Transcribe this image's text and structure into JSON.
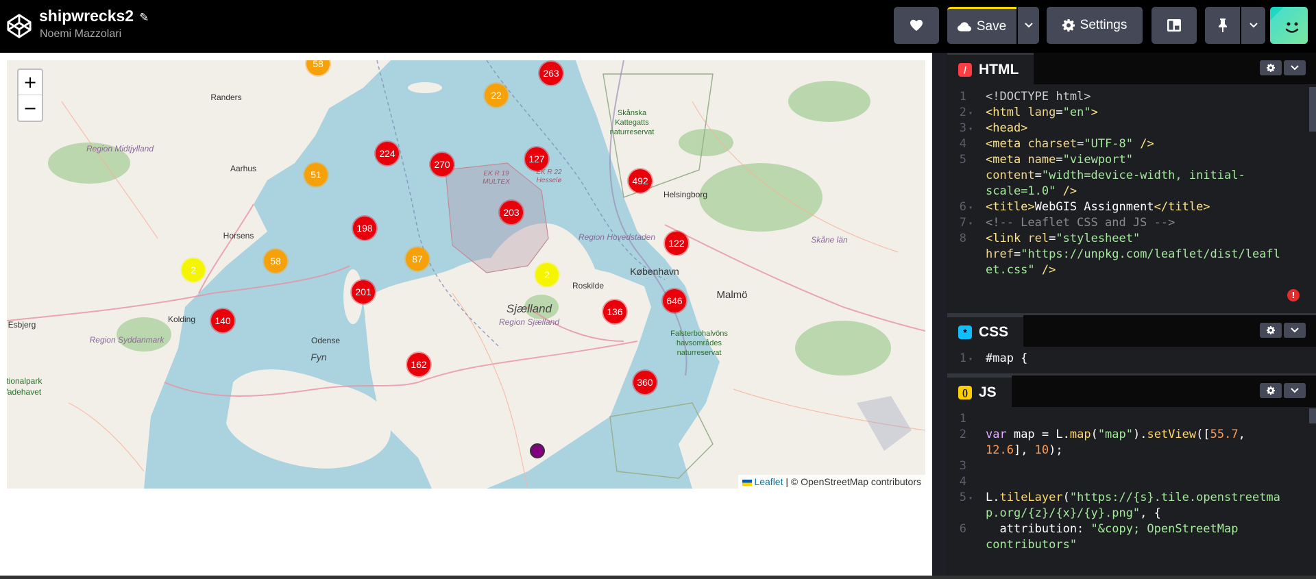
{
  "app": {
    "pen_title": "shipwrecks2",
    "author": "Noemi Mazzolari",
    "buttons": {
      "love_icon": "heart-icon",
      "save_label": "Save",
      "settings_label": "Settings",
      "layout_icon": "layout-icon",
      "pin_icon": "pin-icon"
    }
  },
  "map": {
    "zoom_in": "+",
    "zoom_out": "−",
    "attribution_link": "Leaflet",
    "attribution_rest": "| © OpenStreetMap contributors",
    "place_labels": [
      {
        "id": "randers",
        "text": "Randers"
      },
      {
        "id": "region-midtjylland",
        "text": "Region Midtjylland"
      },
      {
        "id": "aarhus",
        "text": "Aarhus"
      },
      {
        "id": "horsens",
        "text": "Horsens"
      },
      {
        "id": "kolding",
        "text": "Kolding"
      },
      {
        "id": "esbjerg",
        "text": "Esbjerg"
      },
      {
        "id": "region-syddanmark",
        "text": "Region Syddanmark"
      },
      {
        "id": "odense",
        "text": "Odense"
      },
      {
        "id": "fyn",
        "text": "Fyn"
      },
      {
        "id": "nationalpark",
        "text": "ationalpark"
      },
      {
        "id": "vadehavet",
        "text": "Vadehavet"
      },
      {
        "id": "sjaelland",
        "text": "Sjælland"
      },
      {
        "id": "region-sjaelland",
        "text": "Region Sjælland"
      },
      {
        "id": "roskilde",
        "text": "Roskilde"
      },
      {
        "id": "kobenhavn",
        "text": "København"
      },
      {
        "id": "region-hovedstaden",
        "text": "Region Hovedstaden"
      },
      {
        "id": "helsingborg",
        "text": "Helsingborg"
      },
      {
        "id": "malmo",
        "text": "Malmö"
      },
      {
        "id": "skane-lan",
        "text": "Skåne län"
      },
      {
        "id": "skanska-1",
        "text": "Skånska"
      },
      {
        "id": "skanska-2",
        "text": "Kattegatts"
      },
      {
        "id": "skanska-3",
        "text": "naturreservat"
      },
      {
        "id": "ekr19-1",
        "text": "EK R 19"
      },
      {
        "id": "ekr19-2",
        "text": "MULTEX"
      },
      {
        "id": "ekr22-1",
        "text": "EK R 22"
      },
      {
        "id": "ekr22-2",
        "text": "Hesselø"
      },
      {
        "id": "falster-1",
        "text": "Falsterbohalvöns"
      },
      {
        "id": "falster-2",
        "text": "havsområdes"
      },
      {
        "id": "falster-3",
        "text": "naturreservat"
      }
    ],
    "clusters": [
      {
        "count": "58",
        "color": "#f6a10a"
      },
      {
        "count": "263",
        "color": "#e8000b"
      },
      {
        "count": "22",
        "color": "#f6a10a"
      },
      {
        "count": "224",
        "color": "#e8000b"
      },
      {
        "count": "270",
        "color": "#e8000b"
      },
      {
        "count": "127",
        "color": "#e8000b"
      },
      {
        "count": "51",
        "color": "#f6a10a"
      },
      {
        "count": "492",
        "color": "#e8000b"
      },
      {
        "count": "203",
        "color": "#e8000b"
      },
      {
        "count": "198",
        "color": "#e8000b"
      },
      {
        "count": "122",
        "color": "#e8000b"
      },
      {
        "count": "87",
        "color": "#f6a10a"
      },
      {
        "count": "58",
        "color": "#f6a10a"
      },
      {
        "count": "2",
        "color": "#f5f500"
      },
      {
        "count": "2",
        "color": "#f5f500"
      },
      {
        "count": "201",
        "color": "#e8000b"
      },
      {
        "count": "646",
        "color": "#e8000b"
      },
      {
        "count": "136",
        "color": "#e8000b"
      },
      {
        "count": "140",
        "color": "#e8000b"
      },
      {
        "count": "162",
        "color": "#e8000b"
      },
      {
        "count": "360",
        "color": "#e8000b"
      }
    ]
  },
  "editors": {
    "html": {
      "title": "HTML",
      "lines": [
        {
          "n": "1",
          "fold": false,
          "html": "<span class=\"doc\">&lt;!DOCTYPE html&gt;</span>"
        },
        {
          "n": "2",
          "fold": true,
          "html": "<span class=\"tag\">&lt;html</span> <span class=\"attr\">lang</span>=<span class=\"str\">\"en\"</span><span class=\"tag\">&gt;</span>"
        },
        {
          "n": "3",
          "fold": true,
          "html": "<span class=\"tag\">&lt;head&gt;</span>"
        },
        {
          "n": "4",
          "fold": false,
          "html": "<span class=\"tag\">&lt;meta</span> <span class=\"attr\">charset</span>=<span class=\"str\">\"UTF-8\"</span> <span class=\"tag\">/&gt;</span>"
        },
        {
          "n": "5",
          "fold": false,
          "html": "<span class=\"tag\">&lt;meta</span> <span class=\"attr\">name</span>=<span class=\"str\">\"viewport\"</span>"
        },
        {
          "n": "",
          "fold": false,
          "html": "<span class=\"attr\">content</span>=<span class=\"str\">\"width=device-width, initial-</span>"
        },
        {
          "n": "",
          "fold": false,
          "html": "<span class=\"str\">scale=1.0\"</span> <span class=\"tag\">/&gt;</span>"
        },
        {
          "n": "6",
          "fold": true,
          "html": "<span class=\"tag\">&lt;title&gt;</span>WebGIS Assignment<span class=\"tag\">&lt;/title&gt;</span>"
        },
        {
          "n": "7",
          "fold": true,
          "html": "<span class=\"cmt\">&lt;!-- Leaflet CSS and JS --&gt;</span>"
        },
        {
          "n": "8",
          "fold": false,
          "html": "<span class=\"tag\">&lt;link</span> <span class=\"attr\">rel</span>=<span class=\"str\">\"stylesheet\"</span>"
        },
        {
          "n": "",
          "fold": false,
          "html": "<span class=\"attr\">href</span>=<span class=\"str\">\"https://unpkg.com/leaflet/dist/leafl</span>"
        },
        {
          "n": "",
          "fold": false,
          "html": "<span class=\"str\">et.css\"</span> <span class=\"tag\">/&gt;</span>"
        }
      ]
    },
    "css": {
      "title": "CSS",
      "lines": [
        {
          "n": "1",
          "fold": true,
          "html": "#map {"
        }
      ]
    },
    "js": {
      "title": "JS",
      "lines": [
        {
          "n": "1",
          "fold": false,
          "html": ""
        },
        {
          "n": "2",
          "fold": false,
          "html": "<span class=\"kw\">var</span> map = L.<span class=\"fn\">map</span>(<span class=\"str\">\"map\"</span>).<span class=\"fn\">setView</span>([<span class=\"num\">55.7</span>,"
        },
        {
          "n": "",
          "fold": false,
          "html": "<span class=\"num\">12.6</span>], <span class=\"num\">10</span>);"
        },
        {
          "n": "3",
          "fold": false,
          "html": ""
        },
        {
          "n": "4",
          "fold": false,
          "html": ""
        },
        {
          "n": "5",
          "fold": true,
          "html": "L.<span class=\"fn\">tileLayer</span>(<span class=\"str\">\"https://{s}.tile.openstreetma</span>"
        },
        {
          "n": "",
          "fold": false,
          "html": "<span class=\"str\">p.org/{z}/{x}/{y}.png\"</span>, {"
        },
        {
          "n": "6",
          "fold": false,
          "html": "  attribution: <span class=\"str\">\"&amp;copy; OpenStreetMap</span>"
        },
        {
          "n": "",
          "fold": false,
          "html": "<span class=\"str\">contributors\"</span>"
        }
      ]
    }
  }
}
